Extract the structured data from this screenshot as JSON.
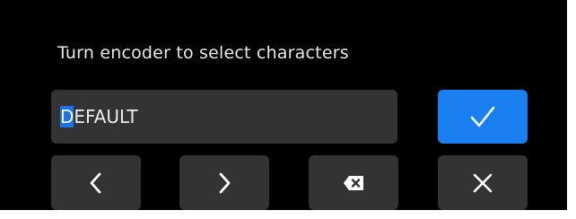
{
  "prompt": {
    "text": "Turn encoder to select characters"
  },
  "text_field": {
    "cursor_char": "D",
    "rest": "EFAULT",
    "cursor_position": 0
  },
  "buttons": {
    "confirm": {
      "icon": "check-icon"
    },
    "cursor_left": {
      "icon": "chevron-left-icon"
    },
    "cursor_right": {
      "icon": "chevron-right-icon"
    },
    "backspace": {
      "icon": "backspace-icon"
    },
    "cancel": {
      "icon": "close-icon"
    }
  },
  "colors": {
    "background": "#000000",
    "button": "#333333",
    "accent": "#1a7ff0",
    "cursor_highlight": "#1a73e8",
    "text": "#e8e8e8"
  }
}
